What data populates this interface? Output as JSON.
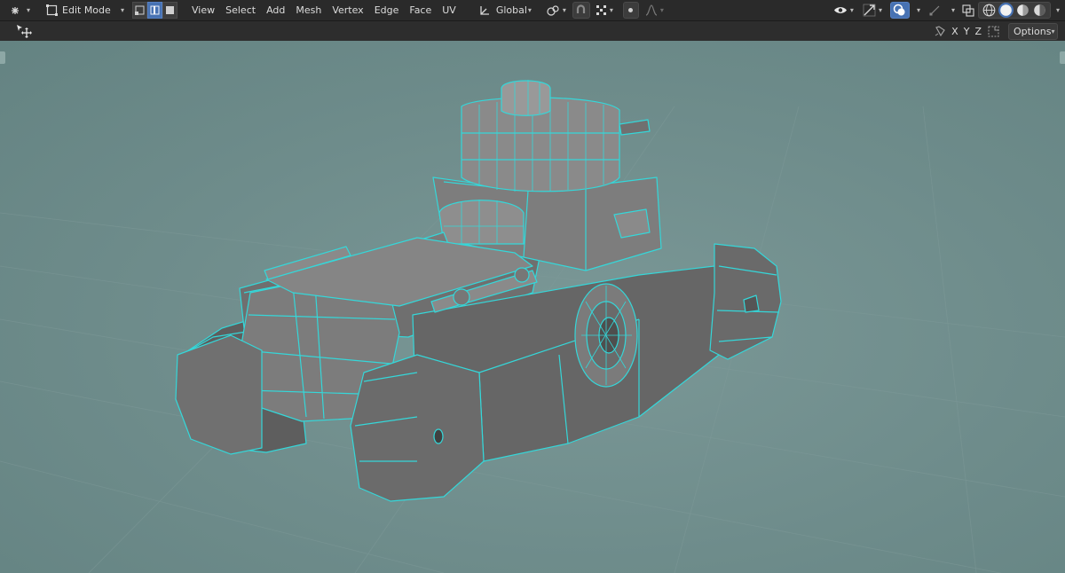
{
  "header": {
    "mode_label": "Edit Mode",
    "menus": [
      "View",
      "Select",
      "Add",
      "Mesh",
      "Vertex",
      "Edge",
      "Face",
      "UV"
    ],
    "transform_orientation": "Global"
  },
  "subbar": {
    "axes": [
      "X",
      "Y",
      "Z"
    ],
    "options_label": "Options"
  },
  "colors": {
    "header_bg": "#2a2a2a",
    "viewport_bg": "#6f8c8b",
    "wire": "#35d7d9",
    "mesh_face": "#6b6b6b",
    "active_blue": "#4772b3"
  },
  "icons": [
    "editor-type-icon",
    "mode-icon",
    "vertex-select-icon",
    "edge-select-icon",
    "face-select-icon",
    "transform-orientation-icon",
    "pivot-icon",
    "snap-icon",
    "snap-grid-icon",
    "proportional-icon",
    "falloff-icon",
    "visibility-icon",
    "gizmo-icon",
    "overlay-icon",
    "xray-icon",
    "wireframe-shading-icon",
    "solid-shading-icon",
    "material-shading-icon",
    "rendered-shading-icon",
    "move-tool-icon",
    "mirror-icon",
    "auto-merge-icon"
  ]
}
